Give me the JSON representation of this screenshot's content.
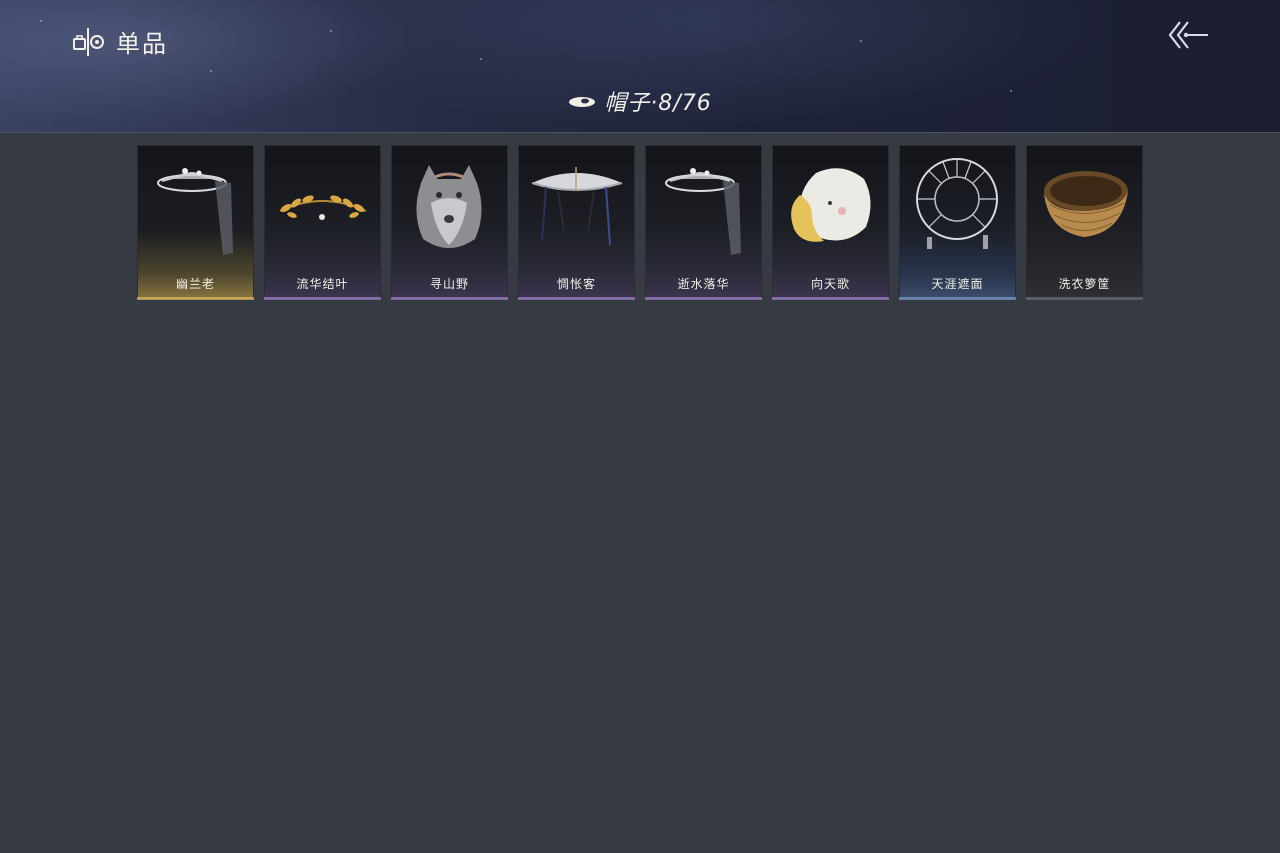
{
  "header": {
    "title": "单品",
    "back_icon": "double-chevron-left-icon",
    "brand_icon": "wardrobe-icon"
  },
  "category": {
    "icon": "hat-icon",
    "title": "帽子·8/76"
  },
  "items": [
    {
      "name": "幽兰老",
      "rarity": "gold",
      "icon": "veiled-hat-icon"
    },
    {
      "name": "流华结叶",
      "rarity": "purple",
      "icon": "golden-laurel-icon"
    },
    {
      "name": "寻山野",
      "rarity": "purple",
      "icon": "wolf-hood-icon"
    },
    {
      "name": "惆怅客",
      "rarity": "purple",
      "icon": "bamboo-hat-icon"
    },
    {
      "name": "逝水落华",
      "rarity": "purple",
      "icon": "veiled-hat-icon"
    },
    {
      "name": "向天歌",
      "rarity": "purple",
      "icon": "goose-hood-icon"
    },
    {
      "name": "天涯遮面",
      "rarity": "blue",
      "icon": "wire-frame-hat-icon"
    },
    {
      "name": "洗衣箩筐",
      "rarity": "plain",
      "icon": "wicker-basket-icon"
    }
  ],
  "colors": {
    "background": "#363a43",
    "gold": "#d9b45a",
    "purple": "#9b7fc5",
    "blue": "#7b97c9"
  }
}
